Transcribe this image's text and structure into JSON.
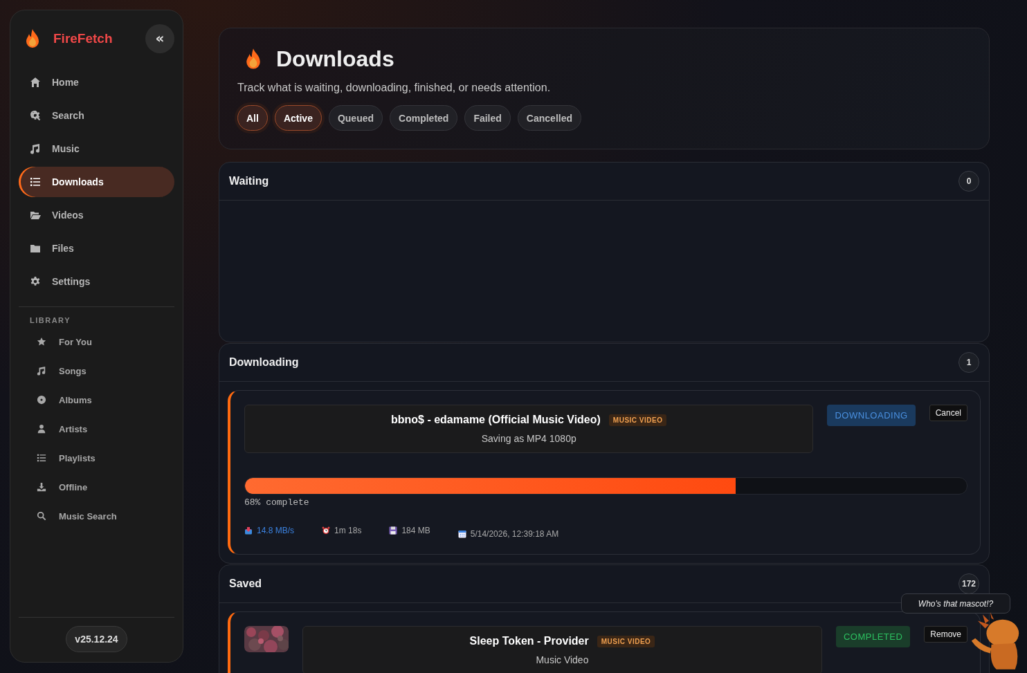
{
  "sidebar": {
    "brand": "FireFetch",
    "collapse_button": "«",
    "items": [
      {
        "label": "Home",
        "selected": false
      },
      {
        "label": "Search",
        "selected": false
      },
      {
        "label": "Music",
        "selected": false
      },
      {
        "label": "Downloads",
        "selected": true
      },
      {
        "label": "Videos",
        "selected": false
      },
      {
        "label": "Files",
        "selected": false
      },
      {
        "label": "Settings",
        "selected": false
      }
    ],
    "library_heading": "LIBRARY",
    "library_items": [
      {
        "label": "For You",
        "selected": false
      },
      {
        "label": "Songs",
        "selected": false
      },
      {
        "label": "Albums",
        "selected": false
      },
      {
        "label": "Artists",
        "selected": false
      },
      {
        "label": "Playlists",
        "selected": false
      },
      {
        "label": "Offline",
        "selected": false
      },
      {
        "label": "Music Search",
        "selected": false
      }
    ],
    "version": "v25.12.24"
  },
  "header": {
    "title": "Downloads",
    "subtitle": "Track what is waiting, downloading, finished, or needs attention.",
    "filters": [
      {
        "label": "All",
        "selected": true
      },
      {
        "label": "Active",
        "selected": true
      },
      {
        "label": "Queued",
        "selected": false
      },
      {
        "label": "Completed",
        "selected": false
      },
      {
        "label": "Failed",
        "selected": false
      },
      {
        "label": "Cancelled",
        "selected": false
      }
    ]
  },
  "sections": [
    {
      "title": "Waiting",
      "count": "0"
    },
    {
      "title": "Downloading",
      "count": "1",
      "items": [
        {
          "kind": "downloading",
          "title": "bbno$ - edamame (Official Music Video)",
          "badge": "MUSIC VIDEO",
          "subtitle": "Saving as MP4 1080p",
          "status": "DOWNLOADING",
          "action": "Cancel",
          "level": 0.68,
          "progress_text": "68% complete",
          "stats": [
            {
              "kind": "speed",
              "text": "14.8 MB/s"
            },
            {
              "kind": "eta",
              "text": "1m 18s"
            },
            {
              "kind": "size",
              "text": "184 MB"
            },
            {
              "kind": "date",
              "text": "5/14/2026, 12:39:18 AM"
            }
          ]
        }
      ]
    },
    {
      "title": "Saved",
      "count": "172",
      "items": [
        {
          "kind": "completed",
          "title": "Sleep Token - Provider",
          "badge": "MUSIC VIDEO",
          "subtitle": "Music Video",
          "status": "COMPLETED",
          "action": "Remove"
        }
      ]
    }
  ],
  "mascot": {
    "tooltip": "Who's that mascot!?"
  }
}
